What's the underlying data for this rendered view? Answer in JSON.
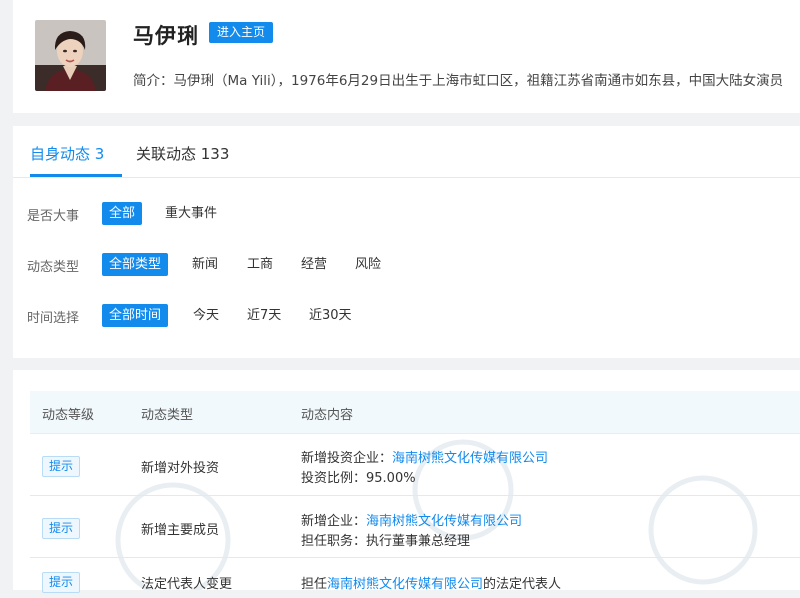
{
  "profile": {
    "name": "马伊琍",
    "home_button": "进入主页",
    "intro": "简介：马伊琍（Ma Yili），1976年6月29日出生于上海市虹口区，祖籍江苏省南通市如东县，中国大陆女演员"
  },
  "tabs": [
    {
      "label": "自身动态 3",
      "active": true
    },
    {
      "label": "关联动态 133",
      "active": false
    }
  ],
  "filters": [
    {
      "label": "是否大事",
      "options": [
        {
          "text": "全部",
          "selected": true
        },
        {
          "text": "重大事件",
          "selected": false
        }
      ]
    },
    {
      "label": "动态类型",
      "options": [
        {
          "text": "全部类型",
          "selected": true
        },
        {
          "text": "新闻",
          "selected": false
        },
        {
          "text": "工商",
          "selected": false
        },
        {
          "text": "经营",
          "selected": false
        },
        {
          "text": "风险",
          "selected": false
        }
      ]
    },
    {
      "label": "时间选择",
      "options": [
        {
          "text": "全部时间",
          "selected": true
        },
        {
          "text": "今天",
          "selected": false
        },
        {
          "text": "近7天",
          "selected": false
        },
        {
          "text": "近30天",
          "selected": false
        }
      ]
    }
  ],
  "table": {
    "headers": [
      "动态等级",
      "动态类型",
      "动态内容"
    ],
    "rows": [
      {
        "level": "提示",
        "type": "新增对外投资",
        "line1_label": "新增投资企业：",
        "line1_link": "海南树熊文化传媒有限公司",
        "line2": "投资比例：95.00%"
      },
      {
        "level": "提示",
        "type": "新增主要成员",
        "line1_label": "新增企业：",
        "line1_link": "海南树熊文化传媒有限公司",
        "line2": "担任职务：执行董事兼总经理"
      },
      {
        "level": "提示",
        "type": "法定代表人变更",
        "line1_label": "担任",
        "line1_link": "海南树熊文化传媒有限公司",
        "line1_suffix": "的法定代表人"
      }
    ]
  },
  "colors": {
    "accent": "#128bed",
    "page_bg": "#f1f2f4",
    "header_bg": "#f2f9fc"
  }
}
